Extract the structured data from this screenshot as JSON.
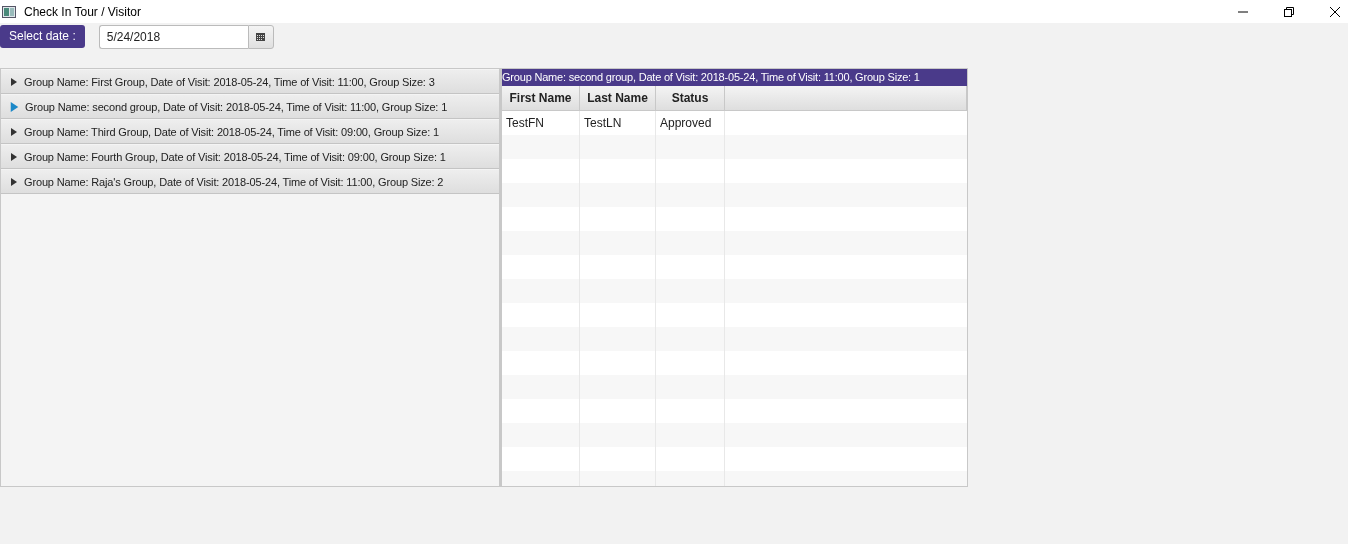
{
  "window": {
    "title": "Check In Tour / Visitor"
  },
  "toolbar": {
    "label": "Select date :",
    "date_field": {
      "value": "5/24/2018"
    }
  },
  "groups": [
    {
      "label": "Group Name: First Group, Date of Visit: 2018-05-24, Time of Visit: 11:00, Group Size: 3",
      "selected": false
    },
    {
      "label": "Group Name: second group, Date of Visit: 2018-05-24, Time of Visit: 11:00, Group Size: 1",
      "selected": true
    },
    {
      "label": "Group Name: Third Group, Date of Visit: 2018-05-24, Time of Visit: 09:00, Group Size: 1",
      "selected": false
    },
    {
      "label": "Group Name: Fourth Group, Date of Visit: 2018-05-24, Time of Visit: 09:00, Group Size: 1",
      "selected": false
    },
    {
      "label": "Group Name: Raja's Group, Date of Visit: 2018-05-24, Time of Visit: 11:00, Group Size: 2",
      "selected": false
    }
  ],
  "detail": {
    "title": "Group Name: second group, Date of Visit: 2018-05-24, Time of Visit: 11:00, Group Size: 1",
    "table": {
      "columns": [
        "First Name",
        "Last Name",
        "Status"
      ],
      "rows": [
        [
          "TestFN",
          "TestLN",
          "Approved"
        ]
      ]
    }
  }
}
